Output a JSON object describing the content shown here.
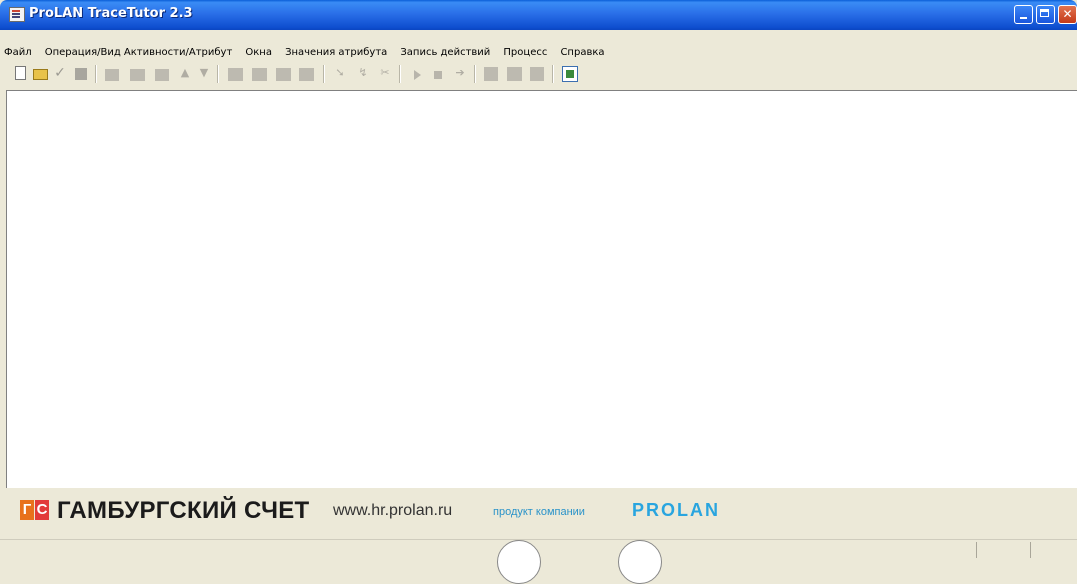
{
  "window": {
    "title": "ProLAN TraceTutor 2.3",
    "controls": [
      "minimize",
      "maximize",
      "close"
    ]
  },
  "menu": {
    "items": [
      "Файл",
      "Операция/Вид Активности/Атрибут",
      "Окна",
      "Значения атрибута",
      "Запись действий",
      "Процесс",
      "Справка"
    ]
  },
  "toolbar": {
    "icons": [
      "new-document-icon",
      "open-folder-icon",
      "check-icon",
      "stop-square-icon",
      "folder-icon",
      "folder-add-icon",
      "folder-edit-icon",
      "move-up-icon",
      "move-down-icon",
      "table-icon",
      "table-add-icon",
      "table-edit-icon",
      "table-remove-icon",
      "cursor-icon",
      "link-icon",
      "cut-icon",
      "play-icon",
      "stop-icon",
      "next-icon",
      "report-icon",
      "report-add-icon",
      "report-remove-icon",
      "export-icon"
    ]
  },
  "banner": {
    "logo_letters": [
      "Г",
      "С"
    ],
    "brand": "ГАМБУРГСКИЙ СЧЕТ",
    "site": "www.hr.prolan.ru",
    "product_text": "продукт компании",
    "company": "PROLAN"
  },
  "colors": {
    "titlebar": "#2a6fe8",
    "logo_orange": "#e8711c",
    "logo_red": "#e23a3a",
    "accent_blue": "#29a5df"
  }
}
